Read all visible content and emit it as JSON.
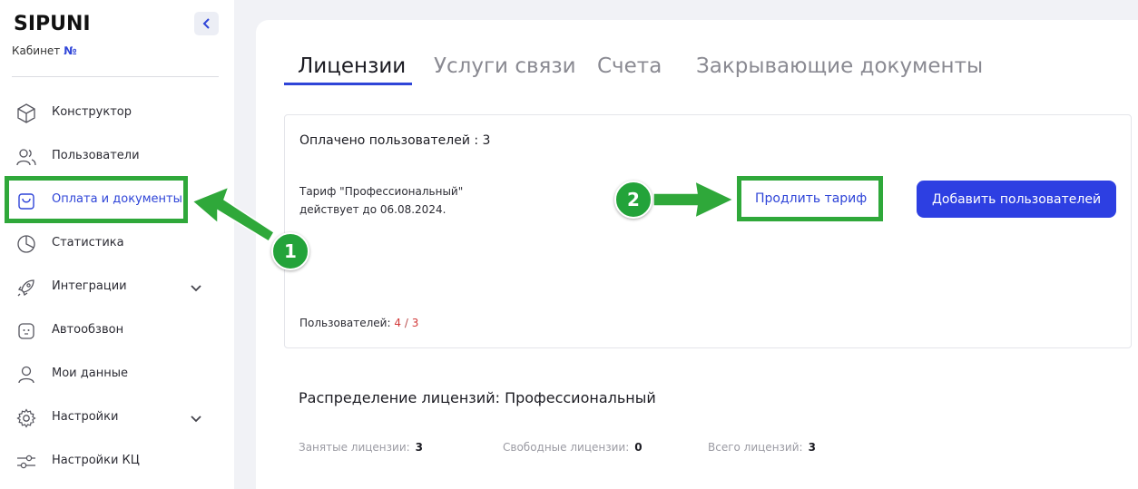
{
  "sidebar": {
    "logo": "SIPUNI",
    "cabinet_label": "Кабинет",
    "cabinet_number": "№",
    "items": [
      {
        "label": "Конструктор",
        "icon": "cube-icon"
      },
      {
        "label": "Пользователи",
        "icon": "users-icon"
      },
      {
        "label": "Оплата и документы",
        "icon": "shopping-bag-icon",
        "active": true
      },
      {
        "label": "Статистика",
        "icon": "pie-chart-icon"
      },
      {
        "label": "Интеграции",
        "icon": "rocket-icon",
        "expandable": true
      },
      {
        "label": "Автообзвон",
        "icon": "robot-icon"
      },
      {
        "label": "Мои данные",
        "icon": "user-icon"
      },
      {
        "label": "Настройки",
        "icon": "gear-icon",
        "expandable": true
      },
      {
        "label": "Настройки КЦ",
        "icon": "sliders-icon"
      }
    ]
  },
  "tabs": [
    {
      "label": "Лицензии",
      "active": true
    },
    {
      "label": "Услуги связи"
    },
    {
      "label": "Счета"
    },
    {
      "label": "Закрывающие документы"
    }
  ],
  "license_card": {
    "paid_users": "Оплачено пользователей : 3",
    "tariff_line1": "Тариф \"Профессиональный\"",
    "tariff_line2": "действует до 06.08.2024.",
    "extend_label": "Продлить тариф",
    "add_users_label": "Добавить пользователей",
    "users_label": "Пользователей:",
    "users_current": "4",
    "users_sep": "/",
    "users_total": "3"
  },
  "distribution": {
    "title": "Распределение лицензий: Профессиональный",
    "occupied_label": "Занятые лицензии:",
    "occupied_value": "3",
    "free_label": "Свободные лицензии:",
    "free_value": "0",
    "total_label": "Всего лицензий:",
    "total_value": "3"
  },
  "annotations": {
    "badge1": "1",
    "badge2": "2"
  },
  "colors": {
    "accent": "#2f45d8",
    "button": "#2d3fe2",
    "annotation_green": "#2fa83a",
    "error_red": "#d23a3a"
  }
}
